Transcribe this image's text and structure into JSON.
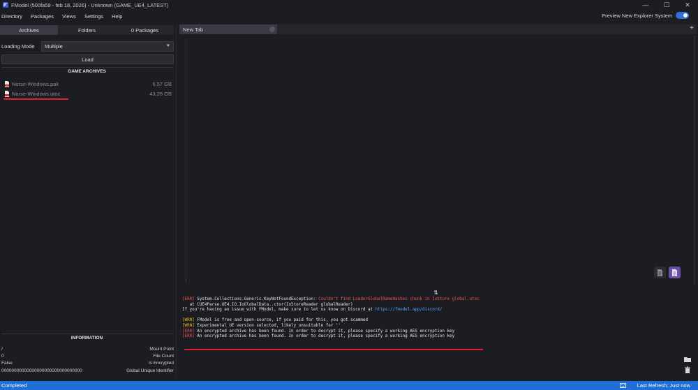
{
  "window": {
    "title": "FModel (500fa59 - feb 18, 2026) - Unknown (GAME_UE4_LATEST)",
    "controls": [
      "—",
      "☐",
      "✕"
    ]
  },
  "menu": [
    "Directory",
    "Packages",
    "Views",
    "Settings",
    "Help"
  ],
  "preview_toggle": {
    "label": "Preview New Explorer System",
    "on": true,
    "accent": "#2f6fd6"
  },
  "left_tabs": [
    {
      "label": "Archives",
      "active": true
    },
    {
      "label": "Folders",
      "active": false
    },
    {
      "label": "0 Packages",
      "active": false
    }
  ],
  "loading": {
    "label": "Loading Mode",
    "value": "Multiple",
    "load_button": "Load"
  },
  "archives": {
    "title": "GAME ARCHIVES",
    "items": [
      {
        "name": "Norse-Windows.pak",
        "size": "6,57 GB",
        "highlighted": false
      },
      {
        "name": "Norse-Windows.utoc",
        "size": "43,28 GB",
        "highlighted": true
      }
    ]
  },
  "information": {
    "title": "INFORMATION",
    "rows": [
      {
        "value": "/",
        "key": "Mount Point"
      },
      {
        "value": "0",
        "key": "File Count"
      },
      {
        "value": "False",
        "key": "Is Encrypted"
      },
      {
        "value": "00000000000000000000000000000000",
        "key": "Global Unique Identifier"
      }
    ]
  },
  "doc_tabs": [
    {
      "label": "New Tab"
    }
  ],
  "log": [
    [
      {
        "t": "[ERR] ",
        "c": "err"
      },
      {
        "t": "System.Collections.Generic.KeyNotFoundException: ",
        "c": "plain"
      },
      {
        "t": "Couldn't find LoaderGlobalNameHashes chunk in IoStore global.utoc",
        "c": "errmsg"
      }
    ],
    [
      {
        "t": "   at CUE4Parse.UE4.IO.IoGlobalData..ctor(IoStoreReader globalReader)",
        "c": "plain"
      }
    ],
    [
      {
        "t": "If you're having an issue with FModel, make sure to let us know on Discord at ",
        "c": "plain"
      },
      {
        "t": "https://fmodel.app/discord/",
        "c": "link"
      }
    ],
    [
      {
        "t": "",
        "c": "plain"
      }
    ],
    [
      {
        "t": "[WRN] ",
        "c": "wrn"
      },
      {
        "t": "FModel is free and open-source, if you paid for this, you got scammed",
        "c": "plain"
      }
    ],
    [
      {
        "t": "[WRN] ",
        "c": "wrn"
      },
      {
        "t": "Experimental UE version selected, likely unsuitable for ''",
        "c": "plain"
      }
    ],
    [
      {
        "t": "[ERR] ",
        "c": "err"
      },
      {
        "t": "An encrypted archive has been found. In order to decrypt it, please specify a working AES encryption key",
        "c": "plain"
      }
    ],
    [
      {
        "t": "[ERR] ",
        "c": "err"
      },
      {
        "t": "An encrypted archive has been found. In order to decrypt it, please specify a working AES encryption key",
        "c": "plain"
      }
    ]
  ],
  "status": {
    "left": "Completed",
    "right": "Last Refresh: Just now",
    "bg": "#1f6fd6"
  },
  "icons": {
    "app": "fmodel-logo-icon",
    "tab_close": "close-circle-icon",
    "add_tab": "plus-icon",
    "editor_actions": [
      "document-icon",
      "image-preview-icon"
    ],
    "splitter": "resize-vertical-icon",
    "log_actions": [
      "folder-icon",
      "trash-icon"
    ],
    "status": "keyboard-icon"
  }
}
